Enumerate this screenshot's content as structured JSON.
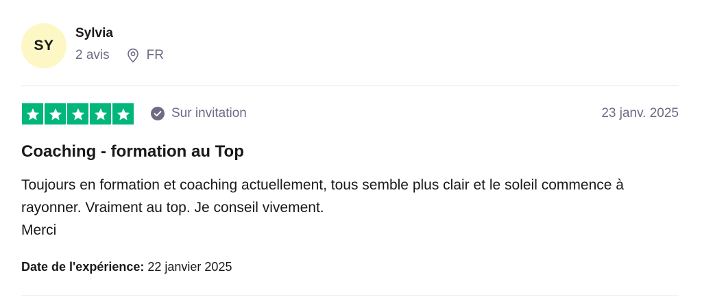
{
  "reviewer": {
    "initials": "SY",
    "name": "Sylvia",
    "review_count": "2 avis",
    "country": "FR"
  },
  "rating": {
    "stars": 5,
    "max_stars": 5,
    "star_color": "#00b67a"
  },
  "verification": {
    "label": "Sur invitation",
    "icon": "check-circle-icon"
  },
  "review": {
    "date": "23 janv. 2025",
    "title": "Coaching - formation au Top",
    "body_lines": [
      "Toujours en formation et coaching actuellement, tous semble plus clair et le soleil commence à rayonner. Vraiment au top. Je conseil vivement.",
      "Merci"
    ],
    "experience_label": "Date de l'expérience:",
    "experience_date": "22 janvier 2025"
  },
  "colors": {
    "avatar_bg": "#fdf7c5",
    "muted_text": "#6c6c85",
    "divider": "#e5e5dd"
  }
}
